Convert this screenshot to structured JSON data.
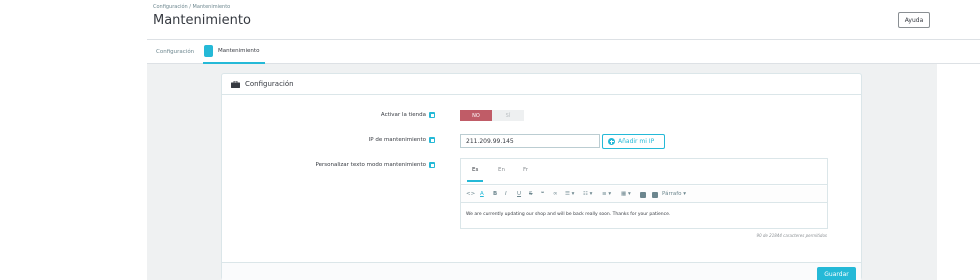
{
  "header": {
    "breadcrumb": "Configuración / Mantenimiento",
    "title": "Mantenimiento",
    "help_label": "Ayuda"
  },
  "tabs": [
    {
      "label": "Configuración",
      "active": false
    },
    {
      "label": "Mantenimiento",
      "active": true
    }
  ],
  "panel": {
    "title": "Configuración",
    "shop_enabled": {
      "label": "Activar la tienda",
      "options": [
        "NO",
        "SÍ"
      ],
      "selected": "NO"
    },
    "maintenance_ip": {
      "label": "IP de mantenimiento",
      "value": "211.209.99.145",
      "add_button": "Añadir mi IP"
    },
    "custom_text": {
      "label": "Personalizar texto modo mantenimiento",
      "languages": [
        "Es",
        "En",
        "Fr"
      ],
      "active_language": "Es",
      "toolbar": {
        "code": "<>",
        "underline_a": "A",
        "bold": "B",
        "italic": "I",
        "underline": "U",
        "strike": "S",
        "quote": "❝",
        "link": "∞",
        "align": "☰ ▾",
        "list_bullets": "☷ ▾",
        "list_numbers": "≡ ▾",
        "table": "▦ ▾",
        "format": "Párrafo ▾"
      },
      "content": "We are currently updating our shop and will be back really soon. Thanks for your patience.",
      "char_count": "90 de 21844 caracteres permitidos"
    },
    "save_label": "Guardar"
  },
  "colors": {
    "accent": "#25b9d7",
    "switch_off": "#c05c67",
    "text": "#363a41"
  }
}
